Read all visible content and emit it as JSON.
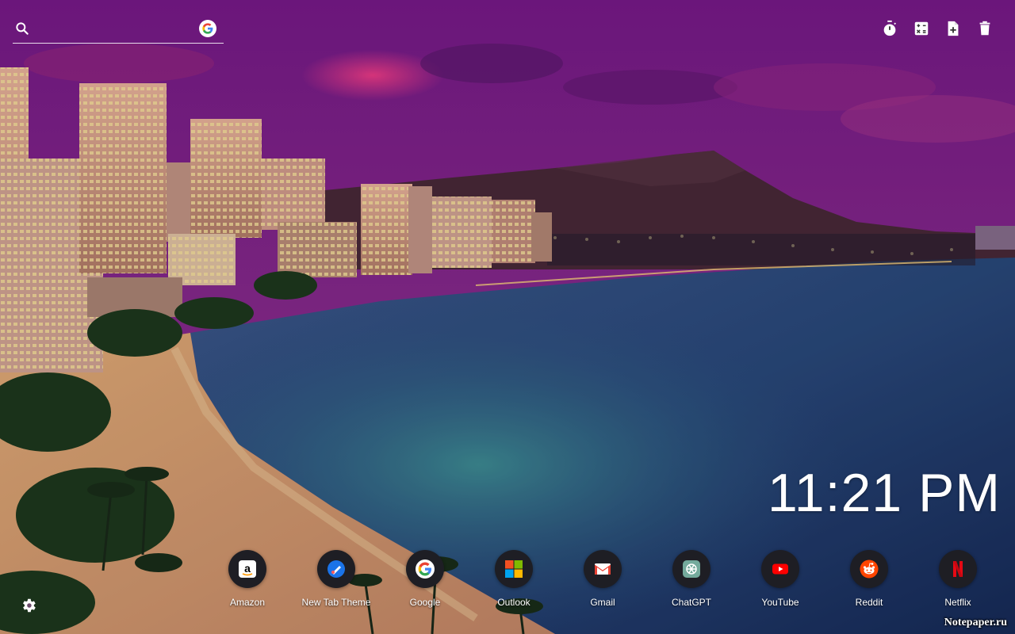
{
  "search": {
    "placeholder": "",
    "value": "",
    "engine_icon": "google-g-icon"
  },
  "toolbar": {
    "icons": [
      "timer-icon",
      "calculator-icon",
      "add-note-icon",
      "trash-icon"
    ]
  },
  "clock": {
    "time": "11:21 PM"
  },
  "shortcuts": [
    {
      "label": "Amazon",
      "icon": "amazon-icon"
    },
    {
      "label": "New Tab Theme",
      "icon": "new-tab-theme-icon"
    },
    {
      "label": "Google",
      "icon": "google-icon"
    },
    {
      "label": "Outlook",
      "icon": "outlook-icon"
    },
    {
      "label": "Gmail",
      "icon": "gmail-icon"
    },
    {
      "label": "ChatGPT",
      "icon": "chatgpt-icon"
    },
    {
      "label": "YouTube",
      "icon": "youtube-icon"
    },
    {
      "label": "Reddit",
      "icon": "reddit-icon"
    },
    {
      "label": "Netflix",
      "icon": "netflix-icon"
    }
  ],
  "settings": {
    "icon": "gear-icon"
  },
  "watermark": {
    "text": "Notepaper.ru"
  },
  "colors": {
    "text": "#ffffff",
    "shortcut_bubble": "#1e1e24",
    "sky_top": "#7a1a8c",
    "ocean": "#1f3f73"
  }
}
